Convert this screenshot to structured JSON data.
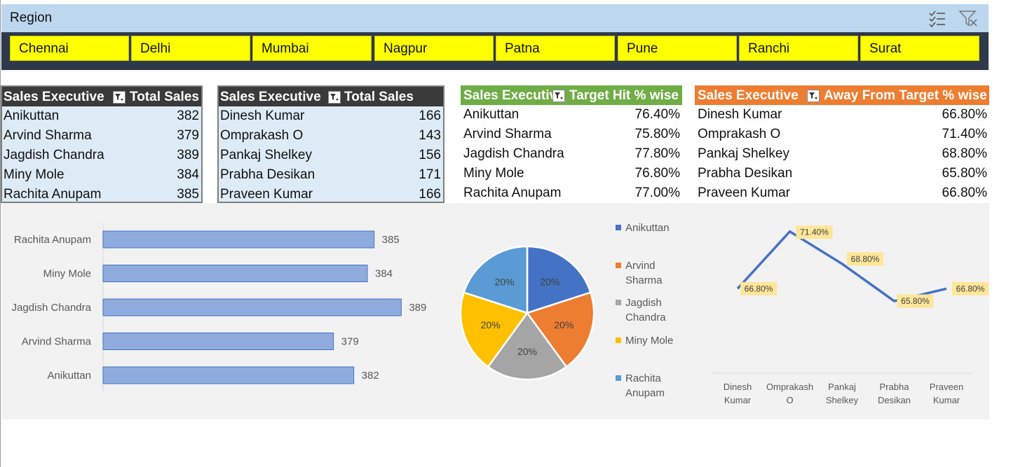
{
  "slicer": {
    "title": "Region",
    "icons": [
      "multi-select-icon",
      "clear-filter-icon"
    ],
    "items": [
      "Chennai",
      "Delhi",
      "Mumbai",
      "Nagpur",
      "Patna",
      "Pune",
      "Ranchi",
      "Surat"
    ],
    "item_color": "#ffff00"
  },
  "table1": {
    "col1": "Sales Executive",
    "col2": "Total Sales",
    "rows": [
      {
        "name": "Anikuttan",
        "value": "382"
      },
      {
        "name": "Arvind Sharma",
        "value": "379"
      },
      {
        "name": "Jagdish Chandra",
        "value": "389"
      },
      {
        "name": "Miny Mole",
        "value": "384"
      },
      {
        "name": "Rachita Anupam",
        "value": "385"
      }
    ]
  },
  "table2": {
    "col1": "Sales Executive",
    "col2": "Total Sales",
    "rows": [
      {
        "name": "Dinesh Kumar",
        "value": "166"
      },
      {
        "name": "Omprakash O",
        "value": "143"
      },
      {
        "name": "Pankaj Shelkey",
        "value": "156"
      },
      {
        "name": "Prabha Desikan",
        "value": "171"
      },
      {
        "name": "Praveen Kumar",
        "value": "166"
      }
    ]
  },
  "table3": {
    "col1": "Sales Executive",
    "col2": "Target Hit % wise",
    "header_color": "#70ad47",
    "rows": [
      {
        "name": "Anikuttan",
        "value": "76.40%"
      },
      {
        "name": "Arvind Sharma",
        "value": "75.80%"
      },
      {
        "name": "Jagdish Chandra",
        "value": "77.80%"
      },
      {
        "name": "Miny Mole",
        "value": "76.80%"
      },
      {
        "name": "Rachita Anupam",
        "value": "77.00%"
      }
    ]
  },
  "table4": {
    "col1": "Sales Executive",
    "col2": "Away From Target % wise",
    "header_color": "#ed7d31",
    "rows": [
      {
        "name": "Dinesh Kumar",
        "value": "66.80%"
      },
      {
        "name": "Omprakash O",
        "value": "71.40%"
      },
      {
        "name": "Pankaj Shelkey",
        "value": "68.80%"
      },
      {
        "name": "Prabha Desikan",
        "value": "65.80%"
      },
      {
        "name": "Praveen Kumar",
        "value": "66.80%"
      }
    ]
  },
  "chart_data": [
    {
      "type": "bar",
      "orientation": "horizontal",
      "categories": [
        "Rachita Anupam",
        "Miny Mole",
        "Jagdish Chandra",
        "Arvind Sharma",
        "Anikuttan"
      ],
      "values": [
        385,
        384,
        389,
        379,
        382
      ],
      "data_labels": [
        "385",
        "384",
        "389",
        "379",
        "382"
      ],
      "bar_color": "#8faadc",
      "xlim": [
        345,
        390
      ],
      "grid": false
    },
    {
      "type": "pie",
      "categories": [
        "Anikuttan",
        "Arvind Sharma",
        "Jagdish Chandra",
        "Miny Mole",
        "Rachita Anupam"
      ],
      "values": [
        20,
        20,
        20,
        20,
        20
      ],
      "data_labels": [
        "20%",
        "20%",
        "20%",
        "20%",
        "20%"
      ],
      "colors": [
        "#4472c4",
        "#ed7d31",
        "#a5a5a5",
        "#ffc000",
        "#5b9bd5"
      ],
      "legend": [
        {
          "lines": [
            "Anikuttan"
          ]
        },
        {
          "lines": [
            "Arvind",
            "Sharma"
          ]
        },
        {
          "lines": [
            "Jagdish",
            "Chandra"
          ]
        },
        {
          "lines": [
            "Miny Mole"
          ]
        },
        {
          "lines": [
            "Rachita",
            "Anupam"
          ]
        }
      ],
      "legend_position": "right"
    },
    {
      "type": "line",
      "categories": [
        [
          "Dinesh",
          "Kumar"
        ],
        [
          "Omprakash",
          "O"
        ],
        [
          "Pankaj",
          "Shelkey"
        ],
        [
          "Prabha",
          "Desikan"
        ],
        [
          "Praveen",
          "Kumar"
        ]
      ],
      "values": [
        66.8,
        71.4,
        68.8,
        65.8,
        66.8
      ],
      "data_labels": [
        "66.80%",
        "71.40%",
        "68.80%",
        "65.80%",
        "66.80%"
      ],
      "line_color": "#4472c4",
      "label_bg": "#ffe699",
      "ylim": [
        60,
        72
      ],
      "grid": false
    }
  ]
}
